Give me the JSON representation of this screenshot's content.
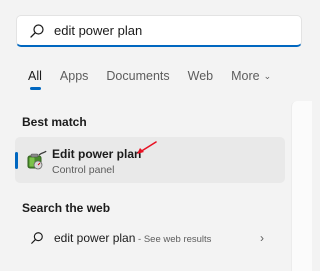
{
  "search": {
    "value": "edit power plan",
    "icon": "search-icon"
  },
  "tabs": [
    {
      "label": "All",
      "active": true
    },
    {
      "label": "Apps",
      "active": false
    },
    {
      "label": "Documents",
      "active": false
    },
    {
      "label": "Web",
      "active": false
    },
    {
      "label": "More",
      "active": false,
      "chevron": "⌄"
    }
  ],
  "best_match": {
    "section_title": "Best match",
    "name": "Edit power plan",
    "subtitle": "Control panel",
    "icon": "power-plan-battery-icon"
  },
  "web": {
    "section_title": "Search the web",
    "query": "edit power plan",
    "suffix": " - See web results",
    "chevron": "›"
  },
  "colors": {
    "accent": "#0067c0",
    "annotation_arrow": "#e81123"
  }
}
